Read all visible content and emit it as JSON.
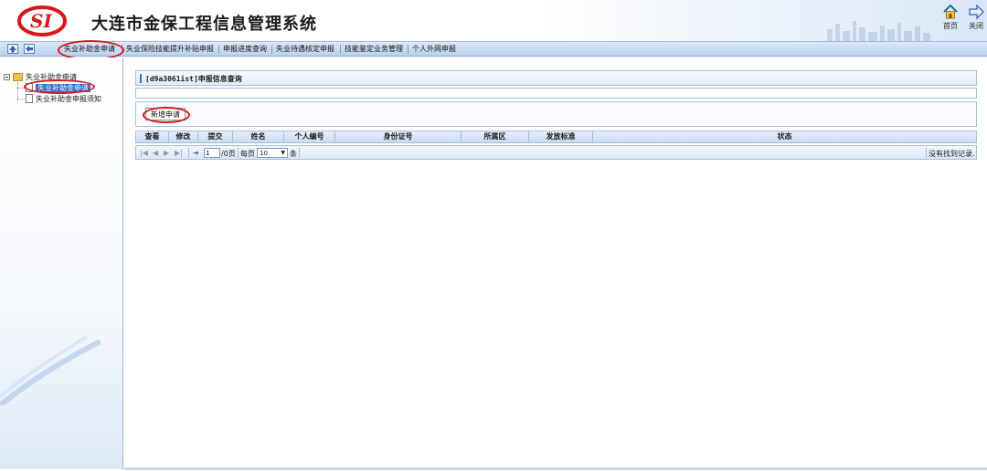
{
  "header": {
    "logo_text": "SI",
    "title": "大连市金保工程信息管理系统",
    "home_label": "首页",
    "close_label": "关闭"
  },
  "menubar": {
    "items": [
      {
        "label": "失业补助金申请",
        "active": true
      },
      {
        "label": "失业保险技能提升补贴申报"
      },
      {
        "label": "申报进度查询"
      },
      {
        "label": "失业待遇核定申报"
      },
      {
        "label": "技能鉴定业务管理"
      },
      {
        "label": "个人外网申报"
      }
    ]
  },
  "sidebar": {
    "root": {
      "label": "失业补助金申请"
    },
    "children": [
      {
        "label": "失业补助金申请",
        "selected": true
      },
      {
        "label": "失业补助金申报须知"
      }
    ]
  },
  "main": {
    "panel_title": "[d9a3061ist]申报信息查询",
    "new_apply_label": "新增申请",
    "columns": [
      "查看",
      "修改",
      "提交",
      "姓名",
      "个人编号",
      "身份证号",
      "所属区",
      "发放标准",
      "状态"
    ],
    "pager": {
      "page_value": "1",
      "page_total": "/0页",
      "per_page_label": "每页",
      "page_size": "10",
      "unit": "条",
      "status": "没有找到记录."
    }
  },
  "colors": {
    "accent_red": "#d8171d",
    "header_blue": "#b9d0ee",
    "border_blue": "#a5bfdf"
  }
}
